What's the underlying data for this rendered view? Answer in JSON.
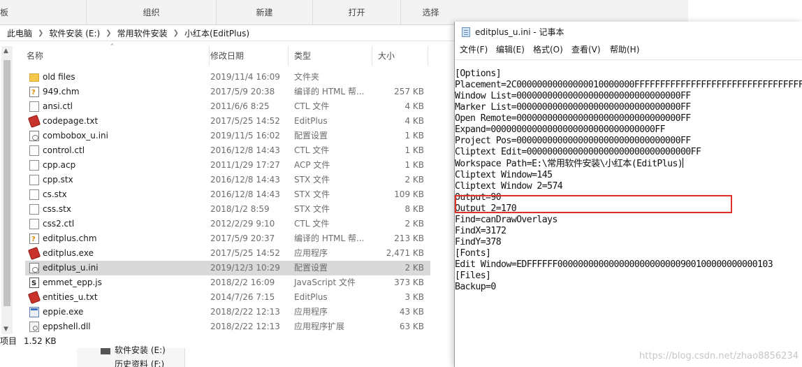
{
  "explorer": {
    "ribbon": {
      "left_stub": "板",
      "groups": [
        "组织",
        "新建",
        "打开",
        "选择"
      ]
    },
    "breadcrumb": [
      "此电脑",
      "软件安装 (E:)",
      "常用软件安装",
      "小红本(EditPlus)"
    ],
    "columns": {
      "name": "名称",
      "date": "修改日期",
      "type": "类型",
      "size": "大小"
    },
    "files": [
      {
        "name": "old files",
        "date": "2019/11/4 16:09",
        "type": "文件夹",
        "size": "",
        "icon": "folder-icon"
      },
      {
        "name": "949.chm",
        "date": "2017/5/9 20:38",
        "type": "编译的 HTML 帮...",
        "size": "257 KB",
        "icon": "chm-icon"
      },
      {
        "name": "ansi.ctl",
        "date": "2011/6/6 8:25",
        "type": "CTL 文件",
        "size": "4 KB",
        "icon": "file-icon"
      },
      {
        "name": "codepage.txt",
        "date": "2017/5/25 14:52",
        "type": "EditPlus",
        "size": "4 KB",
        "icon": "editplus-icon"
      },
      {
        "name": "combobox_u.ini",
        "date": "2019/11/5 16:02",
        "type": "配置设置",
        "size": "1 KB",
        "icon": "ini-icon"
      },
      {
        "name": "control.ctl",
        "date": "2016/12/8 14:43",
        "type": "CTL 文件",
        "size": "1 KB",
        "icon": "file-icon"
      },
      {
        "name": "cpp.acp",
        "date": "2011/1/29 17:27",
        "type": "ACP 文件",
        "size": "1 KB",
        "icon": "file-icon"
      },
      {
        "name": "cpp.stx",
        "date": "2016/12/8 14:43",
        "type": "STX 文件",
        "size": "2 KB",
        "icon": "file-icon"
      },
      {
        "name": "cs.stx",
        "date": "2016/12/8 14:43",
        "type": "STX 文件",
        "size": "109 KB",
        "icon": "file-icon"
      },
      {
        "name": "css.stx",
        "date": "2018/1/2 8:59",
        "type": "STX 文件",
        "size": "8 KB",
        "icon": "file-icon"
      },
      {
        "name": "css2.ctl",
        "date": "2012/2/29 9:10",
        "type": "CTL 文件",
        "size": "2 KB",
        "icon": "file-icon"
      },
      {
        "name": "editplus.chm",
        "date": "2017/5/9 20:37",
        "type": "编译的 HTML 帮...",
        "size": "213 KB",
        "icon": "chm-icon"
      },
      {
        "name": "editplus.exe",
        "date": "2017/5/25 14:52",
        "type": "应用程序",
        "size": "2,471 KB",
        "icon": "editplus-icon"
      },
      {
        "name": "editplus_u.ini",
        "date": "2019/12/3 10:29",
        "type": "配置设置",
        "size": "2 KB",
        "icon": "ini-icon",
        "selected": true
      },
      {
        "name": "emmet_epp.js",
        "date": "2018/2/2 16:09",
        "type": "JavaScript 文件",
        "size": "373 KB",
        "icon": "js-icon"
      },
      {
        "name": "entities_u.txt",
        "date": "2014/7/26 7:15",
        "type": "EditPlus",
        "size": "3 KB",
        "icon": "editplus-icon"
      },
      {
        "name": "eppie.exe",
        "date": "2018/2/22 12:13",
        "type": "应用程序",
        "size": "43 KB",
        "icon": "exe-icon"
      },
      {
        "name": "eppshell.dll",
        "date": "2018/2/22 12:13",
        "type": "应用程序扩展",
        "size": "63 KB",
        "icon": "dll-icon"
      }
    ],
    "status": {
      "count_suffix": "项目",
      "selected_size": "1.52 KB"
    },
    "navtree": [
      "软件安装 (E:)",
      "历史资料 (F:)"
    ]
  },
  "notepad": {
    "title": "editplus_u.ini - 记事本",
    "menu": [
      "文件(F)",
      "编辑(E)",
      "格式(O)",
      "查看(V)",
      "帮助(H)"
    ],
    "lines": [
      "[Options]",
      "Placement=2C00000000000000010000000FFFFFFFFFFFFFFFFFFFFFFFFFFFFFFFFFF",
      "Window List=00000000000000000000000000000000FF",
      "Marker List=00000000000000000000000000000000FF",
      "Open Remote=00000000000000000000000000000000FF",
      "Expand=00000000000000000000000000000000FF",
      "Project Pos=00000000000000000000000000000000FF",
      "Cliptext Edit=00000000000000000000000000000000FF",
      "Workspace Path=E:\\常用软件安装\\小红本(EditPlus)",
      "Cliptext Window=145",
      "Cliptext Window 2=574",
      "Output=90",
      "Output 2=170",
      "Find=canDrawOverlays",
      "FindX=3172",
      "FindY=378",
      "[Fonts]",
      "Edit Window=EDFFFFFF000000000000000000000000900100000000000103",
      "[Files]",
      "Backup=0"
    ],
    "watermark": "https://blog.csdn.net/zhao8856234"
  }
}
